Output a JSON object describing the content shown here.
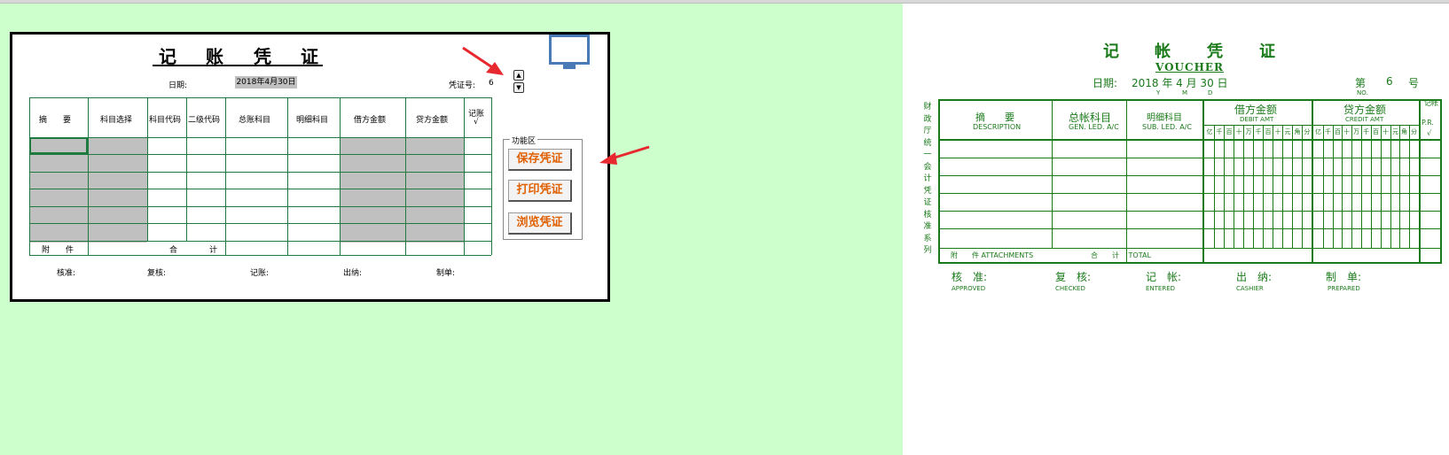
{
  "form": {
    "title": [
      "记",
      "账",
      "凭",
      "证"
    ],
    "date_label": "日期:",
    "date_value": "2018年4月30日",
    "voucher_no_label": "凭证号:",
    "voucher_no": "6",
    "columns": [
      "摘　　要",
      "科目选择",
      "科目代码",
      "二级代码",
      "总账科目",
      "明细科目",
      "借方金额",
      "贷方金额",
      "记账",
      "√"
    ],
    "attachment_label": "附　　件",
    "total_label": "合　　　　计",
    "footer": [
      "核准:",
      "复核:",
      "记账:",
      "出纳:",
      "制单:"
    ],
    "function_area_label": "功能区",
    "buttons": [
      "保存凭证",
      "打印凭证",
      "浏览凭证"
    ]
  },
  "voucher": {
    "title": [
      "记",
      "帐",
      "凭",
      "证"
    ],
    "subtitle": "VOUCHER",
    "date_label": "日期:",
    "date_value": "2018 年 4 月 30 日",
    "ymd": [
      "Y",
      "M",
      "D"
    ],
    "no_label": "第",
    "no_value": "6",
    "no_suffix": "号",
    "no_en": "NO.",
    "side_text": "财政厅统一会计凭证核准系列",
    "headers": {
      "desc_cn": "摘　　要",
      "desc_en": "DESCRIPTION",
      "gen_cn": "总帐科目",
      "gen_en": "GEN. LED. A/C",
      "sub_cn": "明细科目",
      "sub_en": "SUB. LED. A/C",
      "debit_cn": "借方金额",
      "debit_en": "DEBIT AMT",
      "credit_cn": "贷方金额",
      "credit_en": "CREDIT AMT",
      "pr_cn": "记帐",
      "pr_en": "P.R.",
      "pr_check": "√"
    },
    "digits": [
      "亿",
      "千",
      "百",
      "十",
      "万",
      "千",
      "百",
      "十",
      "元",
      "角",
      "分"
    ],
    "attach_text": "附　　件 ATTACHMENTS",
    "total_text": "合　　计　 TOTAL",
    "footer": [
      {
        "cn": "核　准:",
        "en": "APPROVED"
      },
      {
        "cn": "复　核:",
        "en": "CHECKED"
      },
      {
        "cn": "记　帐:",
        "en": "ENTERED"
      },
      {
        "cn": "出　纳:",
        "en": "CASHIER"
      },
      {
        "cn": "制　单:",
        "en": "PREPARED"
      }
    ]
  },
  "colors": {
    "sheet_background": "#ccffcc",
    "voucher_green": "#1a7a1a",
    "button_text": "#e06000",
    "arrow": "#e8282f",
    "monitor": "#4a7bb7"
  }
}
